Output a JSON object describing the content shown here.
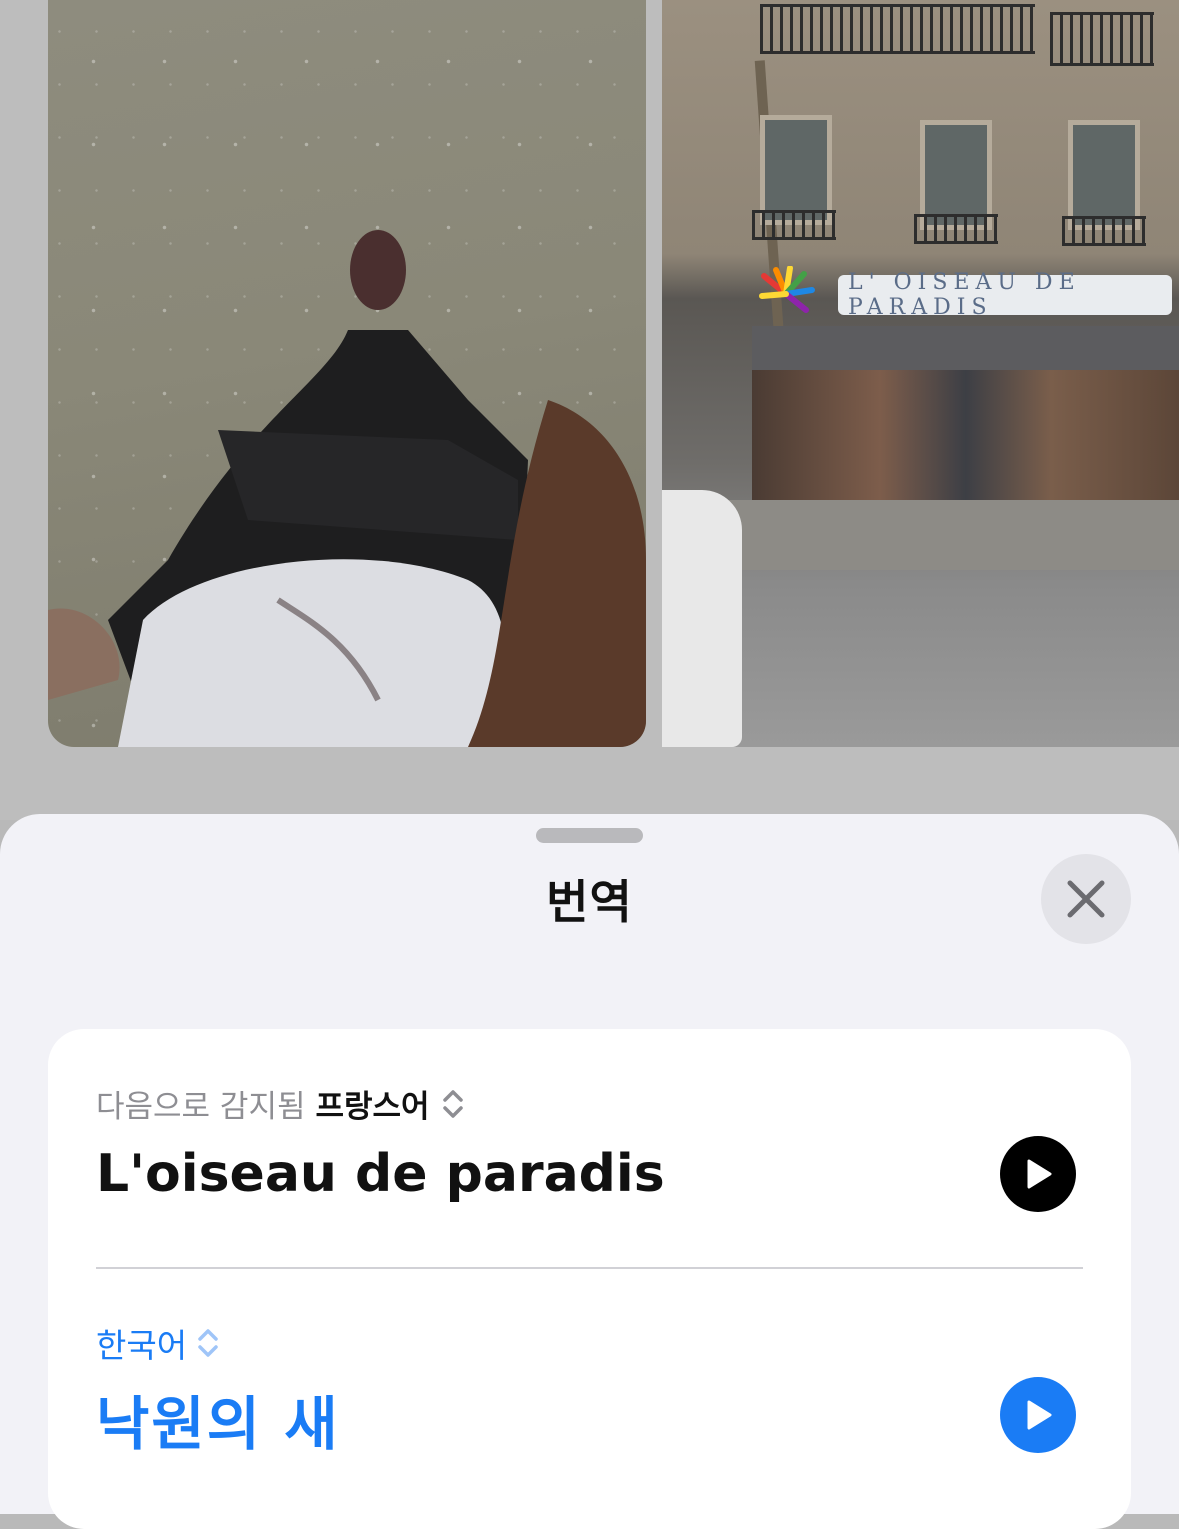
{
  "sheet": {
    "title": "번역",
    "close_icon": "close-icon"
  },
  "photos": {
    "left": "photo-feet-on-pavement",
    "right": "photo-shop-street",
    "shop_sign": "L' OISEAU DE PARADIS"
  },
  "translation": {
    "detected_prefix": "다음으로 감지됨",
    "source_language": "프랑스어",
    "source_text": "L'oiseau de paradis",
    "target_language": "한국어",
    "target_text": "낙원의 새"
  },
  "colors": {
    "accent": "#1a7cf5",
    "sheet_background": "#f2f2f7",
    "card_background": "#ffffff"
  }
}
